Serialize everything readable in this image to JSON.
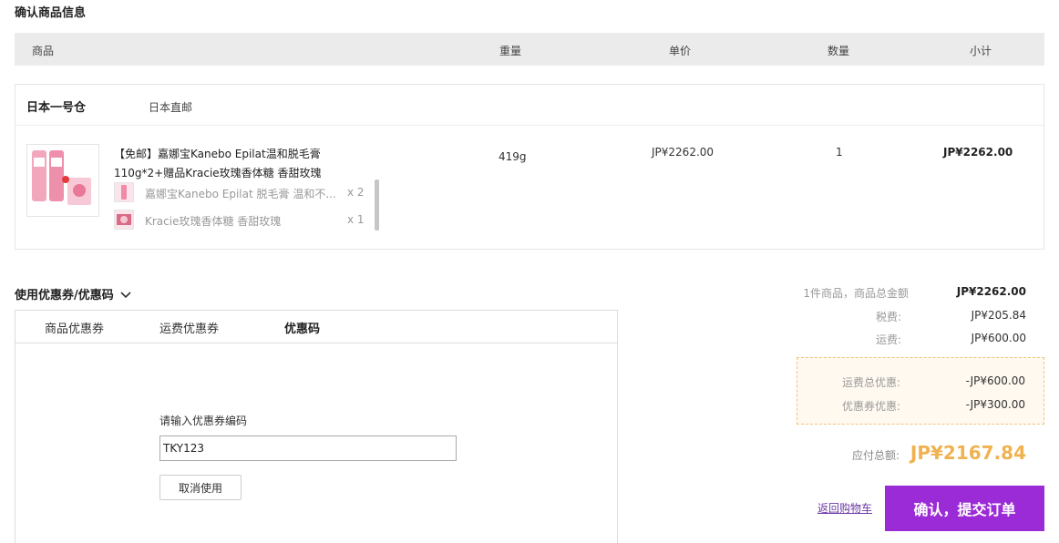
{
  "section_title": "确认商品信息",
  "table_header": {
    "product": "商品",
    "weight": "重量",
    "unit_price": "单价",
    "quantity": "数量",
    "subtotal": "小计"
  },
  "warehouse": {
    "name": "日本一号仓",
    "shipping": "日本直邮"
  },
  "product": {
    "title": "【免邮】嘉娜宝Kanebo Epilat温和脱毛膏110g*2+赠品Kracie玫瑰香体糖 香甜玫瑰",
    "weight": "419g",
    "unit_price": "JP¥2262.00",
    "quantity": "1",
    "subtotal": "JP¥2262.00",
    "sub_items": [
      {
        "name": "嘉娜宝Kanebo Epilat 脱毛膏 温和不...",
        "qty": "x 2"
      },
      {
        "name": "Kracie玫瑰香体糖 香甜玫瑰",
        "qty": "x 1"
      }
    ]
  },
  "coupon": {
    "title": "使用优惠券/优惠码",
    "tabs": [
      "商品优惠券",
      "运费优惠券",
      "优惠码"
    ],
    "code_label": "请输入优惠券编码",
    "code_value": "TKY123",
    "cancel_label": "取消使用"
  },
  "summary": {
    "items_label": "1件商品，商品总金额",
    "items_value": "JP¥2262.00",
    "tax_label": "税费:",
    "tax_value": "JP¥205.84",
    "shipping_label": "运费:",
    "shipping_value": "JP¥600.00",
    "shipping_discount_label": "运费总优惠:",
    "shipping_discount_value": "-JP¥600.00",
    "coupon_discount_label": "优惠券优惠:",
    "coupon_discount_value": "-JP¥300.00",
    "due_label": "应付总额:",
    "due_value": "JP¥2167.84"
  },
  "actions": {
    "back_label": "返回购物车",
    "submit_label": "确认，提交订单"
  },
  "colors": {
    "accent": "#9b2bd6",
    "due": "#f0b24f",
    "discount_border": "#f0c27a"
  }
}
